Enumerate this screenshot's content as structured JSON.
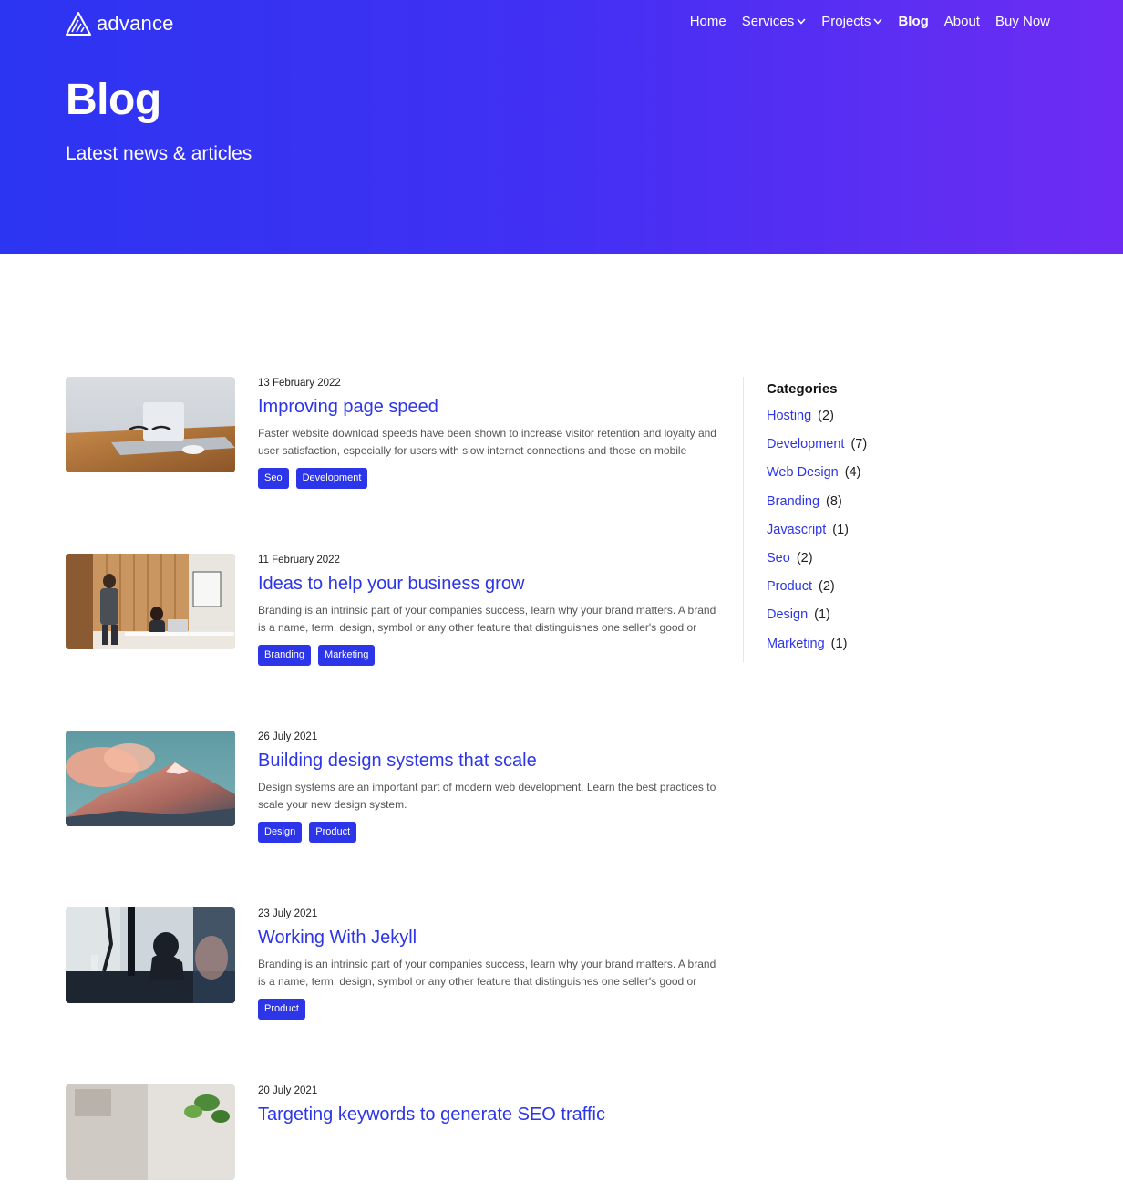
{
  "brand": {
    "name": "advance",
    "accent": "#2c35e8",
    "gradient_start": "#2c35f2",
    "gradient_end": "#6e2cf3"
  },
  "nav": {
    "items": [
      {
        "label": "Home",
        "dropdown": false,
        "active": false
      },
      {
        "label": "Services",
        "dropdown": true,
        "active": false
      },
      {
        "label": "Projects",
        "dropdown": true,
        "active": false
      },
      {
        "label": "Blog",
        "dropdown": false,
        "active": true
      },
      {
        "label": "About",
        "dropdown": false,
        "active": false
      },
      {
        "label": "Buy Now",
        "dropdown": false,
        "active": false
      }
    ]
  },
  "hero": {
    "title": "Blog",
    "subtitle": "Latest news & articles"
  },
  "posts": [
    {
      "date": "13 February 2022",
      "title": "Improving page speed",
      "excerpt": "Faster website download speeds have been shown to increase visitor retention and loyalty and user satisfaction, especially for users with slow internet connections and those on mobile devices.",
      "tags": [
        "Seo",
        "Development"
      ],
      "image": "laptop-desk-image"
    },
    {
      "date": "11 February 2022",
      "title": "Ideas to help your business grow",
      "excerpt": "Branding is an intrinsic part of your companies success, learn why your brand matters. A brand is a name, term, design, symbol or any other feature that distinguishes one seller's good or service fro…",
      "tags": [
        "Branding",
        "Marketing"
      ],
      "image": "office-people-image"
    },
    {
      "date": "26 July 2021",
      "title": "Building design systems that scale",
      "excerpt": "Design systems are an important part of modern web development. Learn the best practices to scale your new design system.",
      "tags": [
        "Design",
        "Product"
      ],
      "image": "mountain-image"
    },
    {
      "date": "23 July 2021",
      "title": "Working With Jekyll",
      "excerpt": "Branding is an intrinsic part of your companies success, learn why your brand matters. A brand is a name, term, design, symbol or any other feature that distinguishes one seller's good or service fro…",
      "tags": [
        "Product"
      ],
      "image": "silhouette-cafe-image"
    },
    {
      "date": "20 July 2021",
      "title": "Targeting keywords to generate SEO traffic",
      "excerpt": "",
      "tags": [],
      "image": "plant-image"
    }
  ],
  "categories": {
    "title": "Categories",
    "items": [
      {
        "label": "Hosting",
        "count": "(2)"
      },
      {
        "label": "Development",
        "count": "(7)"
      },
      {
        "label": "Web Design",
        "count": "(4)"
      },
      {
        "label": "Branding",
        "count": "(8)"
      },
      {
        "label": "Javascript",
        "count": "(1)"
      },
      {
        "label": "Seo",
        "count": "(2)"
      },
      {
        "label": "Product",
        "count": "(2)"
      },
      {
        "label": "Design",
        "count": "(1)"
      },
      {
        "label": "Marketing",
        "count": "(1)"
      }
    ]
  }
}
